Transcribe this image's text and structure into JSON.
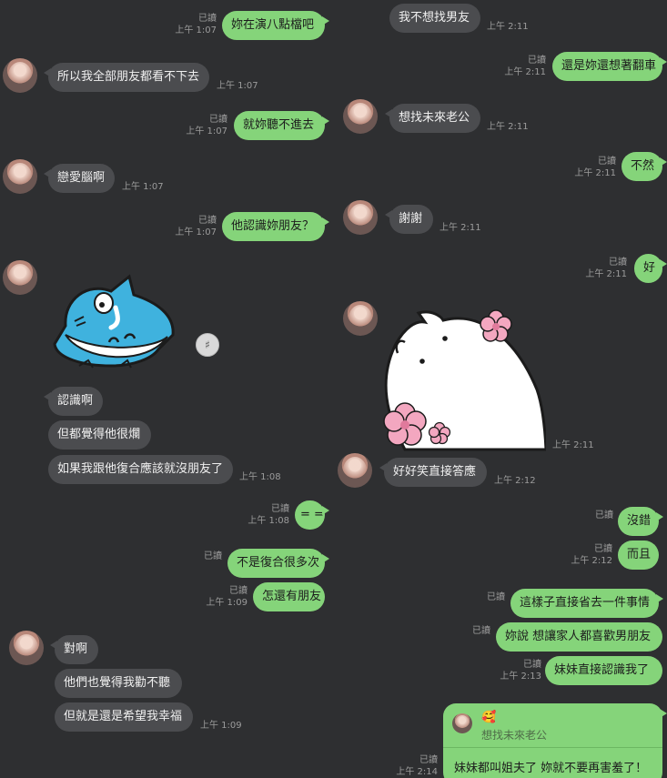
{
  "read_label": "已讀",
  "left": {
    "m1": {
      "text": "妳在演八點檔吧",
      "time": "上午 1:07"
    },
    "m2": {
      "text": "所以我全部朋友都看不下去",
      "time": "上午 1:07"
    },
    "m3": {
      "text": "就妳聽不進去",
      "time": "上午 1:07"
    },
    "m4": {
      "text": "戀愛腦啊",
      "time": "上午 1:07"
    },
    "m5": {
      "text": "他認識妳朋友？",
      "time": "上午 1:07"
    },
    "m6": {
      "text": "認識啊"
    },
    "m7": {
      "text": "但都覺得他很爛"
    },
    "m8": {
      "text": "如果我跟他復合應該就沒朋友了",
      "time": "上午 1:08"
    },
    "m9": {
      "text": "= =",
      "time": "上午 1:08"
    },
    "m10": {
      "text": "不是復合很多次"
    },
    "m11": {
      "text": "怎還有朋友",
      "time": "上午 1:09"
    },
    "m12": {
      "text": "對啊"
    },
    "m13": {
      "text": "他們也覺得我勸不聽"
    },
    "m14": {
      "text": "但就是還是希望我幸福",
      "time": "上午 1:09"
    }
  },
  "right": {
    "m1": {
      "text": "我不想找男友",
      "time": "上午 2:11"
    },
    "m2": {
      "text": "還是妳還想著翻車",
      "time": "上午 2:11"
    },
    "m3": {
      "text": "想找未來老公",
      "time": "上午 2:11"
    },
    "m4": {
      "text": "不然",
      "time": "上午 2:11"
    },
    "m5": {
      "text": "謝謝",
      "time": "上午 2:11"
    },
    "m6": {
      "text": "好",
      "time": "上午 2:11"
    },
    "m7": {
      "time": "上午 2:11"
    },
    "m8": {
      "text": "好好笑直接答應",
      "time": "上午 2:12"
    },
    "m9": {
      "text": "沒錯"
    },
    "m10": {
      "text": "而且",
      "time": "上午 2:12"
    },
    "m11": {
      "text": "這樣子直接省去一件事情"
    },
    "m12": {
      "text": "妳說 想讓家人都喜歡男朋友"
    },
    "m13": {
      "text": "妹妹直接認識我了",
      "time": "上午 2:13"
    },
    "reply": {
      "quoted": "想找未來老公",
      "text": "妹妹都叫姐夫了  妳就不要再害羞了！",
      "time": "上午 2:14",
      "emoji": "🥰"
    }
  },
  "colors": {
    "background": "#2e2f31",
    "my_bubble": "#85d47a",
    "their_bubble": "#4b4c4f",
    "meta_text": "#9c9c9c"
  },
  "icons": {
    "speaker": "speaker-icon",
    "avatar": "profile-photo"
  }
}
